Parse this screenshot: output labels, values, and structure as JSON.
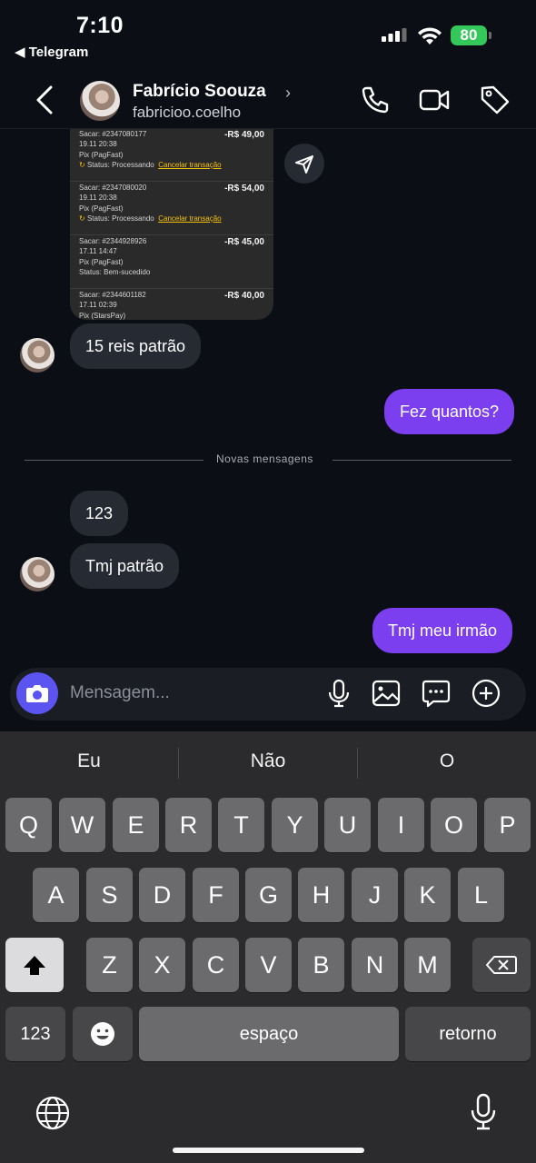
{
  "status": {
    "time": "7:10",
    "back_app": "◀ Telegram",
    "battery": "80"
  },
  "header": {
    "name": "Fabrício Soouza",
    "username": "fabricioo.coelho"
  },
  "receipt": {
    "rows": [
      {
        "line1": "Sacar: #2347080177",
        "line2": "19.11 20:38",
        "line3": "Pix (PagFast)",
        "status": "Status: Processando",
        "link": "Cancelar transação",
        "amount": "-R$ 49,00"
      },
      {
        "line1": "Sacar: #2347080020",
        "line2": "19.11 20:38",
        "line3": "Pix (PagFast)",
        "status": "Status: Processando",
        "link": "Cancelar transação",
        "amount": "-R$ 54,00"
      },
      {
        "line1": "Sacar: #2344928926",
        "line2": "17.11 14:47",
        "line3": "Pix (PagFast)",
        "status": "Status: Bem-sucedido",
        "link": "",
        "amount": "-R$ 45,00"
      },
      {
        "line1": "Sacar: #2344601182",
        "line2": "17.11 02:39",
        "line3": "Pix (StarsPay)",
        "status": "",
        "link": "",
        "amount": "-R$ 40,00"
      }
    ]
  },
  "messages": {
    "m1": "15 reis patrão",
    "m2": "Fez quantos?",
    "separator": "Novas mensagens",
    "m3": "123",
    "m4": "Tmj patrão",
    "m5": "Tmj meu irmão"
  },
  "composer": {
    "placeholder": "Mensagem..."
  },
  "keyboard": {
    "suggestions": [
      "Eu",
      "Não",
      "O"
    ],
    "row1": [
      "Q",
      "W",
      "E",
      "R",
      "T",
      "Y",
      "U",
      "I",
      "O",
      "P"
    ],
    "row2": [
      "A",
      "S",
      "D",
      "F",
      "G",
      "H",
      "J",
      "K",
      "L"
    ],
    "row3": [
      "Z",
      "X",
      "C",
      "V",
      "B",
      "N",
      "M"
    ],
    "numbers_label": "123",
    "space_label": "espaço",
    "return_label": "retorno"
  }
}
